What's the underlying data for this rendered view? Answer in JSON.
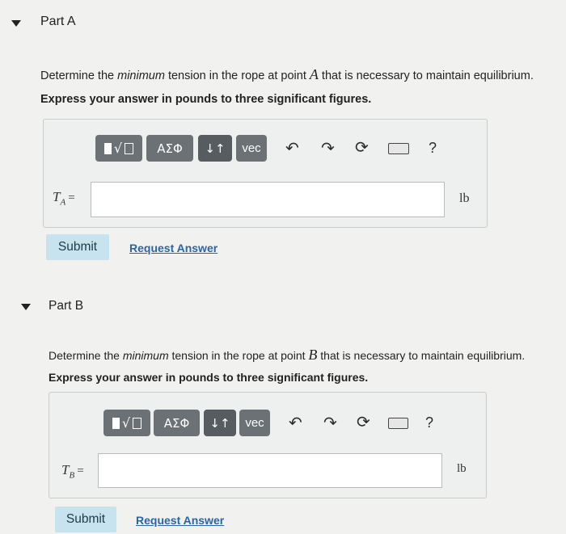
{
  "part_a": {
    "title": "Part A",
    "question_pre": "Determine the ",
    "question_em": "minimum",
    "question_mid": " tension in the rope at point ",
    "question_point": "A",
    "question_post": " that is necessary to maintain equilibrium.",
    "instruction": "Express your answer in pounds to three significant figures.",
    "var_symbol": "T",
    "var_sub": "A",
    "var_eq": "=",
    "answer_value": "",
    "unit": "lb",
    "submit_label": "Submit",
    "request_label": "Request Answer"
  },
  "part_b": {
    "title": "Part B",
    "question_pre": "Determine the ",
    "question_em": "minimum",
    "question_mid": " tension in the rope at point ",
    "question_point": "B",
    "question_post": " that is necessary to maintain equilibrium.",
    "instruction": "Express your answer in pounds to three significant figures.",
    "var_symbol": "T",
    "var_sub": "B",
    "var_eq": "=",
    "answer_value": "",
    "unit": "lb",
    "submit_label": "Submit",
    "request_label": "Request Answer"
  },
  "toolbar": {
    "greek_label": "ΑΣΦ",
    "sort_label": "↓↑",
    "vec_label": "vec",
    "help_label": "?"
  },
  "icons": {
    "templates": "templates-icon",
    "undo": "undo-icon",
    "redo": "redo-icon",
    "reset": "reset-icon",
    "keyboard": "keyboard-icon"
  }
}
